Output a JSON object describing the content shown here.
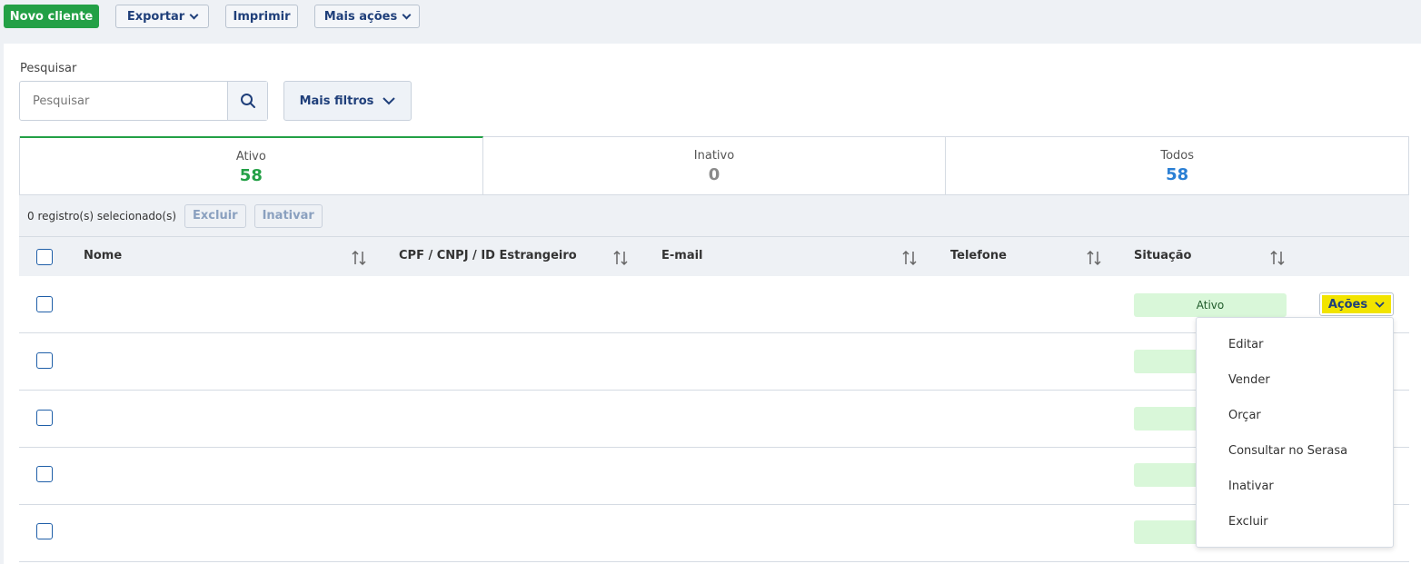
{
  "toolbar": {
    "new_client": "Novo cliente",
    "export": "Exportar",
    "print": "Imprimir",
    "more_actions": "Mais ações"
  },
  "search": {
    "label": "Pesquisar",
    "placeholder": "Pesquisar",
    "more_filters": "Mais filtros"
  },
  "tabs": [
    {
      "label": "Ativo",
      "count": "58",
      "color": "#23a046"
    },
    {
      "label": "Inativo",
      "count": "0",
      "color": "#8a8a8a"
    },
    {
      "label": "Todos",
      "count": "58",
      "color": "#2a7fd4"
    }
  ],
  "selection": {
    "text": "0 registro(s) selecionado(s)",
    "delete": "Excluir",
    "deactivate": "Inativar"
  },
  "table": {
    "columns": [
      "Nome",
      "CPF / CNPJ / ID Estrangeiro",
      "E-mail",
      "Telefone",
      "Situação"
    ],
    "rows": [
      {
        "status": "Ativo"
      },
      {
        "status": ""
      },
      {
        "status": ""
      },
      {
        "status": ""
      },
      {
        "status": ""
      }
    ]
  },
  "actions": {
    "label": "Ações",
    "menu": [
      "Editar",
      "Vender",
      "Orçar",
      "Consultar no Serasa",
      "Inativar",
      "Excluir"
    ]
  },
  "colors": {
    "primary_green": "#23a046",
    "highlight_yellow": "#f2e400",
    "link_blue": "#1f3f7a"
  }
}
